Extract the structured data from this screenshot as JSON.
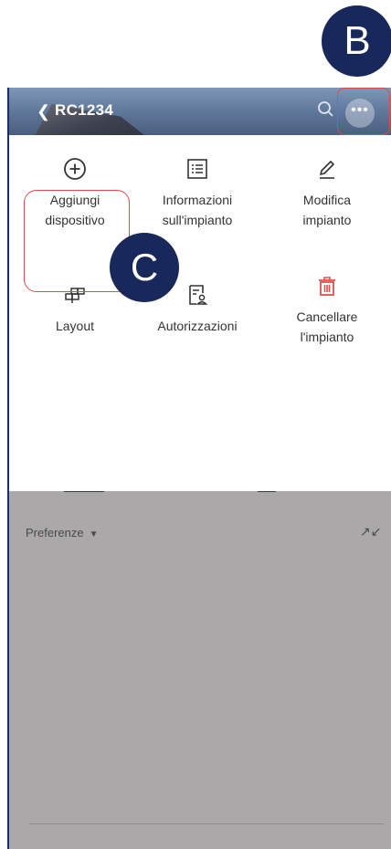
{
  "header": {
    "title": "RC1234"
  },
  "menu": {
    "items": [
      {
        "label_line1": "Aggiungi",
        "label_line2": "dispositivo",
        "icon": "plus-circle-icon"
      },
      {
        "label_line1": "Informazioni",
        "label_line2": "sull'impianto",
        "icon": "list-document-icon"
      },
      {
        "label_line1": "Modifica",
        "label_line2": "impianto",
        "icon": "pencil-icon"
      },
      {
        "label_line1": "Layout",
        "label_line2": "",
        "icon": "layout-grid-icon"
      },
      {
        "label_line1": "Autorizzazioni",
        "label_line2": "",
        "icon": "authorization-icon"
      },
      {
        "label_line1": "Cancellare",
        "label_line2": "l'impianto",
        "icon": "trash-icon"
      }
    ]
  },
  "background": {
    "preferences_label": "Preferenze"
  },
  "callouts": {
    "b": "B",
    "c": "C"
  },
  "colors": {
    "badge": "#18285a",
    "highlight": "#e14b4b",
    "delete": "#e0504e",
    "overlay": "#aaa8a9"
  }
}
